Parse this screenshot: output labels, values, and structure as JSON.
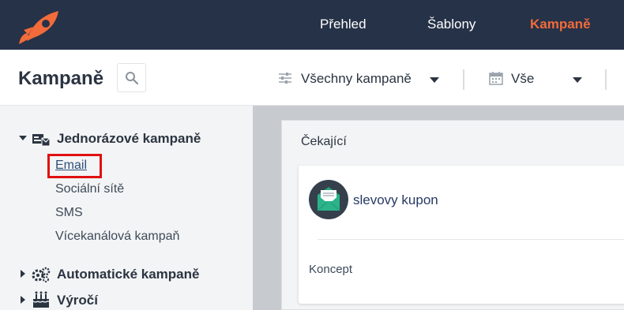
{
  "nav": {
    "items": [
      {
        "label": "Přehled"
      },
      {
        "label": "Šablony"
      },
      {
        "label": "Kampaně"
      }
    ]
  },
  "header": {
    "title": "Kampaně",
    "filter_campaigns": "Všechny kampaně",
    "filter_date": "Vše"
  },
  "sidebar": {
    "sections": [
      {
        "label": "Jednorázové kampaně",
        "icon": "one-time-campaign-icon",
        "expanded": true
      },
      {
        "label": "Automatické kampaně",
        "icon": "gears-icon",
        "expanded": false
      },
      {
        "label": "Výročí",
        "icon": "cake-icon",
        "expanded": false
      }
    ],
    "subitems": [
      {
        "label": "Email"
      },
      {
        "label": "Sociální sítě"
      },
      {
        "label": "SMS"
      },
      {
        "label": "Vícekanálová kampaň"
      }
    ]
  },
  "main": {
    "panel_title": "Čekající",
    "card": {
      "title": "slevovy kupon",
      "status": "Koncept"
    }
  },
  "colors": {
    "nav_bg": "#263248",
    "accent": "#f26b3a",
    "highlight": "#e01010",
    "email_icon": "#2bb38a"
  }
}
